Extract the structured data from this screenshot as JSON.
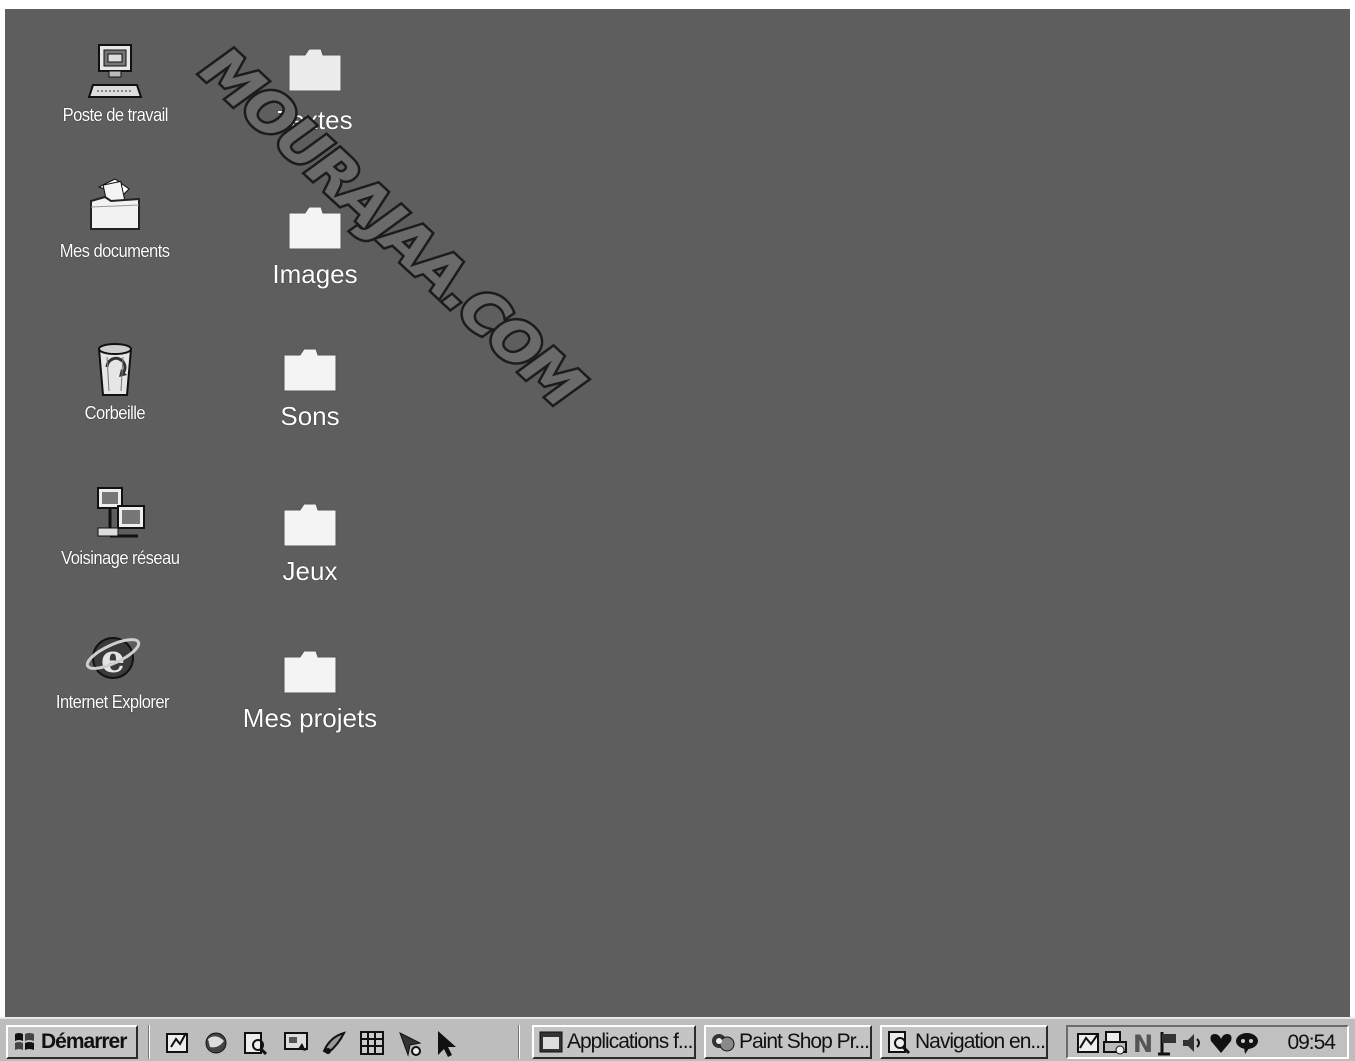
{
  "watermark": "MOURAJAA.COM",
  "desktop": {
    "system_icons": [
      {
        "label": "Poste de travail",
        "icon": "computer-icon"
      },
      {
        "label": "Mes documents",
        "icon": "my-documents-icon"
      },
      {
        "label": "Corbeille",
        "icon": "recycle-bin-icon"
      },
      {
        "label": "Voisinage réseau",
        "icon": "network-neighborhood-icon"
      },
      {
        "label": "Internet Explorer",
        "icon": "internet-explorer-icon"
      }
    ],
    "folders": [
      {
        "label": "Textes",
        "icon": "folder-icon"
      },
      {
        "label": "Images",
        "icon": "folder-icon"
      },
      {
        "label": "Sons",
        "icon": "folder-icon"
      },
      {
        "label": "Jeux",
        "icon": "folder-icon"
      },
      {
        "label": "Mes projets",
        "icon": "folder-icon"
      }
    ]
  },
  "taskbar": {
    "start_label": "Démarrer",
    "quick_launch": [
      "quick-launch-icon",
      "browser-icon",
      "search-icon",
      "desktop-icon",
      "paint-icon",
      "grid-icon",
      "arrow-icon",
      "cursor-icon"
    ],
    "tasks": [
      {
        "label": "Applications f...",
        "icon": "window-icon"
      },
      {
        "label": "Paint Shop Pr...",
        "icon": "paint-shop-icon"
      },
      {
        "label": "Navigation en...",
        "icon": "explorer-search-icon"
      }
    ],
    "tray_icons": [
      "graph-icon",
      "printer-icon",
      "n-icon",
      "flag-icon",
      "speaker-icon",
      "heart-icon",
      "chat-icon"
    ],
    "clock": "09:54"
  },
  "colors": {
    "desktop": "#5e5e5e",
    "taskbar": "#bdbdbd",
    "label": "#ffffff"
  }
}
